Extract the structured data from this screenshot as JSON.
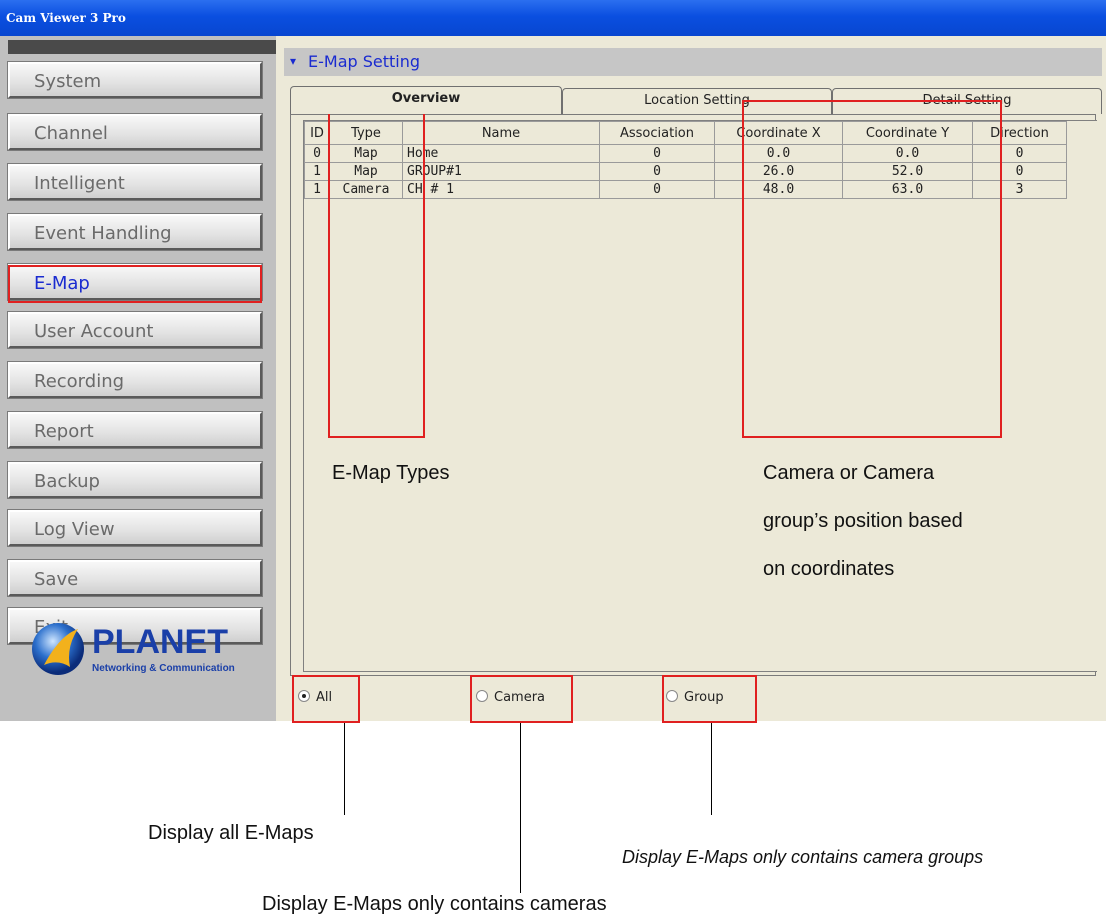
{
  "window": {
    "title": "Cam Viewer 3 Pro"
  },
  "sidebar": {
    "items": [
      {
        "label": "System"
      },
      {
        "label": "Channel"
      },
      {
        "label": "Intelligent"
      },
      {
        "label": "Event Handling"
      },
      {
        "label": "E-Map",
        "active": true
      },
      {
        "label": "User Account"
      },
      {
        "label": "Recording"
      },
      {
        "label": "Report"
      },
      {
        "label": "Backup"
      },
      {
        "label": "Log View"
      },
      {
        "label": "Save"
      },
      {
        "label": "Exit"
      }
    ],
    "logo": {
      "brand": "PLANET",
      "tagline": "Networking & Communication"
    }
  },
  "section": {
    "title": "E-Map Setting"
  },
  "tabs": [
    {
      "label": "Overview",
      "active": true
    },
    {
      "label": "Location Setting"
    },
    {
      "label": "Detail Setting"
    }
  ],
  "table": {
    "columns": [
      "ID",
      "Type",
      "Name",
      "Association",
      "Coordinate X",
      "Coordinate Y",
      "Direction"
    ],
    "rows": [
      [
        "0",
        "Map",
        "Home",
        "0",
        "0.0",
        "0.0",
        "0"
      ],
      [
        "1",
        "Map",
        "GROUP#1",
        "0",
        "26.0",
        "52.0",
        "0"
      ],
      [
        "1",
        "Camera",
        "CH # 1",
        "0",
        "48.0",
        "63.0",
        "3"
      ]
    ]
  },
  "filters": [
    {
      "label": "All",
      "selected": true
    },
    {
      "label": "Camera",
      "selected": false
    },
    {
      "label": "Group",
      "selected": false
    }
  ],
  "annotations": {
    "types": "E-Map Types",
    "coords_line1": "Camera or Camera",
    "coords_line2": "group’s position based",
    "coords_line3": "on coordinates",
    "all": "Display all E-Maps",
    "camera": "Display E-Maps only contains cameras",
    "group": "Display E-Maps only contains camera groups"
  },
  "colors": {
    "highlight": "#e02020",
    "active_text": "#1a2bd0",
    "titlebar": "#0a4fe0"
  }
}
